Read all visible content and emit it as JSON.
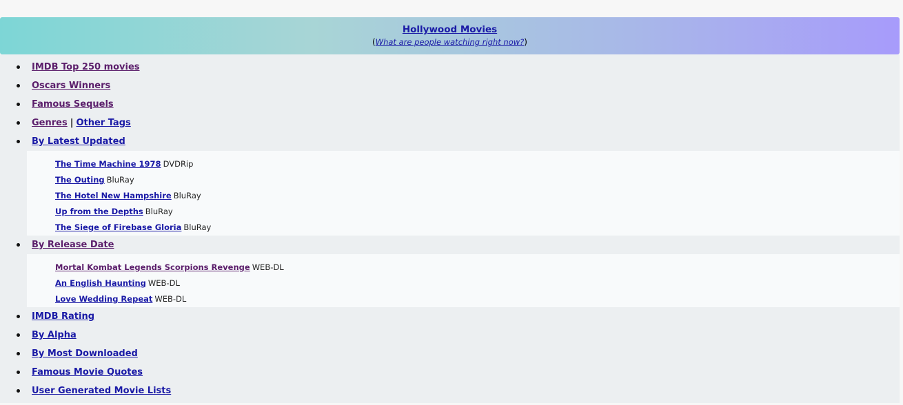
{
  "header": {
    "title": "Hollywood Movies",
    "open_paren": "(",
    "subtitle_link": "What are people watching right now?",
    "close_paren": ")"
  },
  "nav": [
    {
      "label": "IMDB Top 250 movies"
    },
    {
      "label": "Oscars Winners"
    },
    {
      "label": "Famous Sequels"
    },
    {
      "label": "Genres",
      "separator": "|",
      "label2": "Other Tags"
    },
    {
      "label": "By Latest Updated"
    },
    {
      "label": "By Release Date"
    },
    {
      "label": "IMDB Rating"
    },
    {
      "label": "By Alpha"
    },
    {
      "label": "By Most Downloaded"
    },
    {
      "label": "Famous Movie Quotes"
    },
    {
      "label": "User Generated Movie Lists"
    }
  ],
  "latest_updated": [
    {
      "title": "The Time Machine 1978",
      "quality": "DVDRip"
    },
    {
      "title": "The Outing",
      "quality": "BluRay"
    },
    {
      "title": "The Hotel New Hampshire",
      "quality": "BluRay"
    },
    {
      "title": "Up from the Depths",
      "quality": "BluRay"
    },
    {
      "title": "The Siege of Firebase Gloria",
      "quality": "BluRay"
    }
  ],
  "release_date": [
    {
      "title": "Mortal Kombat Legends Scorpions Revenge",
      "quality": "WEB-DL"
    },
    {
      "title": "An English Haunting",
      "quality": "WEB-DL"
    },
    {
      "title": "Love Wedding Repeat",
      "quality": "WEB-DL"
    }
  ],
  "colors": {
    "link": "#1a1aa6",
    "visited_link": "#5b1e6b",
    "header_gradient_start": "#7dd6d6",
    "header_gradient_end": "#a79bfb",
    "panel_bg": "#eceff1"
  }
}
